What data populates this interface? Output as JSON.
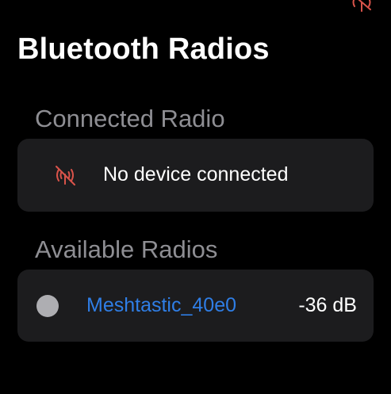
{
  "status_bar": {
    "icon": "antenna-slash-icon",
    "icon_color": "#d9534a"
  },
  "header": {
    "title": "Bluetooth Radios"
  },
  "connected_section": {
    "header": "Connected Radio",
    "status_icon": "antenna-slash-icon",
    "status_icon_color": "#d9534a",
    "status_text": "No device connected"
  },
  "available_section": {
    "header": "Available Radios",
    "radios": [
      {
        "name": "Meshtastic_40e0",
        "signal": "-36 dB",
        "status_dot_color": "#aeaeb2",
        "name_color": "#2f7ee6"
      }
    ]
  },
  "colors": {
    "background": "#000000",
    "card": "#1c1c1e",
    "secondary_text": "#8e8e93",
    "accent": "#2f7ee6",
    "error": "#d9534a"
  }
}
